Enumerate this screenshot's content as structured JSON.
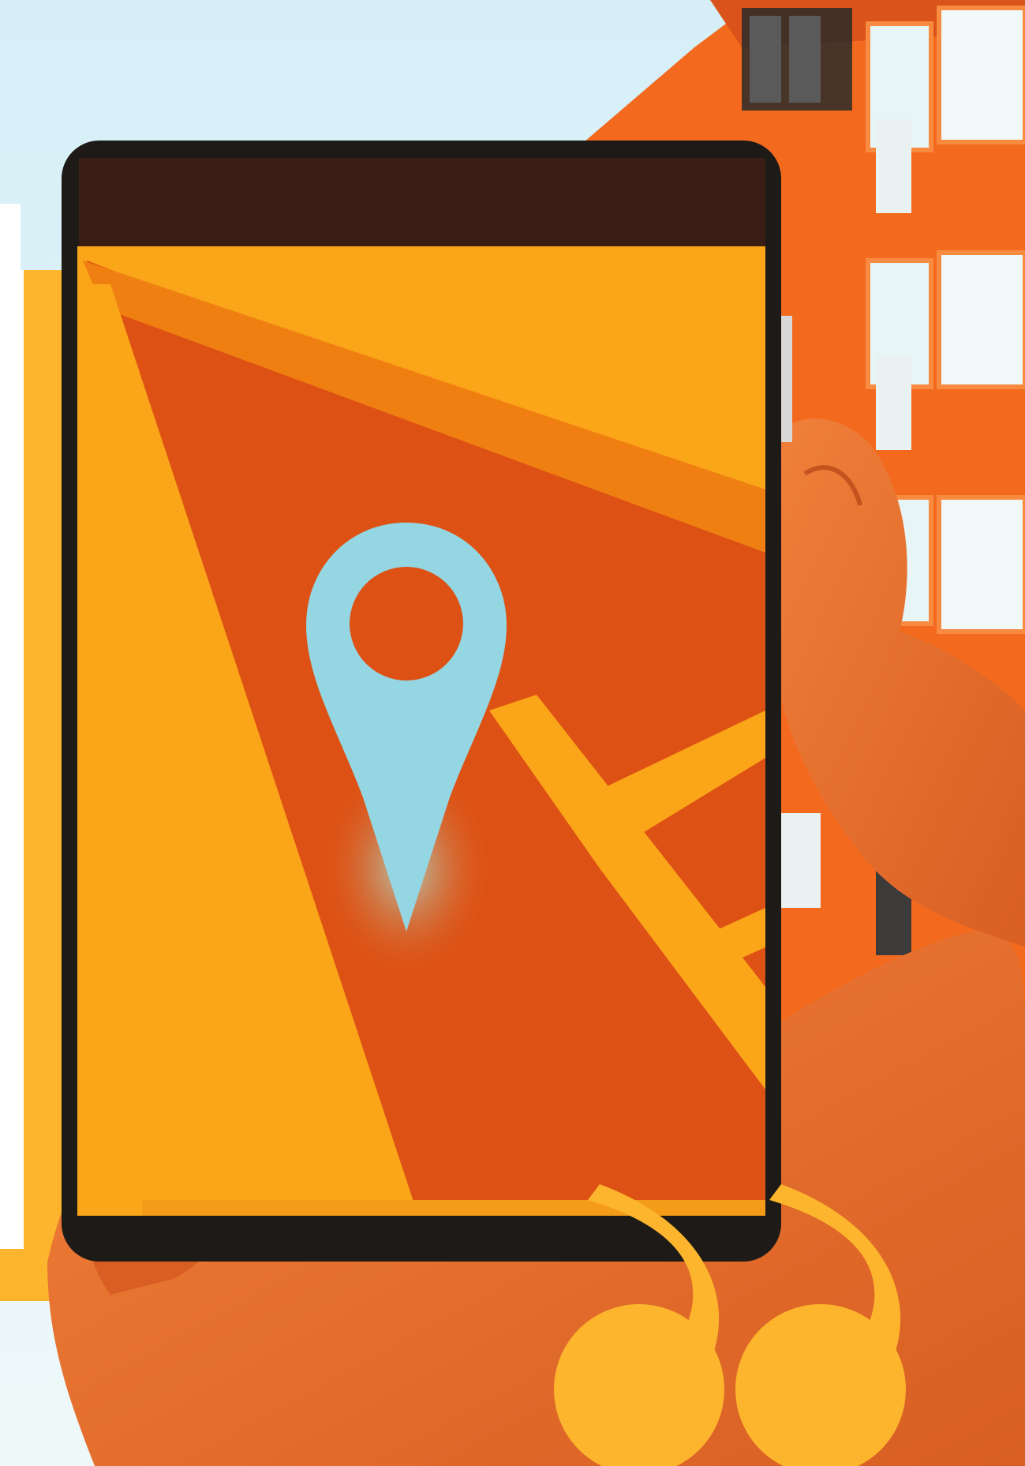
{
  "scene": {
    "description_free": true
  },
  "colors": {
    "sky": "#d8f0f7",
    "building": "#f36a1e",
    "building_dark": "#d9531a",
    "window": "#e9f6f7",
    "phone_frame": "#1e1a18",
    "phone_top": "#3a1d14",
    "map_yellow": "#fba519",
    "map_orange": "#dd5214",
    "map_mid": "#f07f12",
    "pin": "#95d6e3",
    "skin": "#e46c2a",
    "skin_shadow": "#c4531f",
    "accent": "#fdb52d",
    "panel_white": "#ffffff"
  },
  "icons": {
    "map_pin": "location-pin-icon",
    "quote": "closing-quote-icon"
  }
}
